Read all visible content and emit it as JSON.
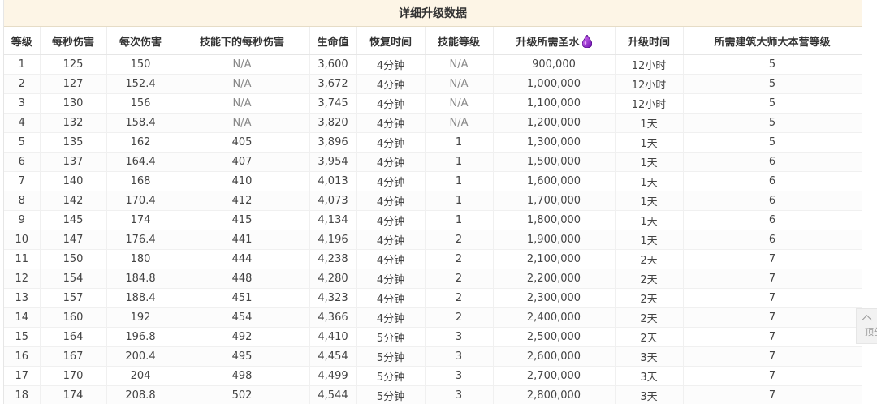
{
  "table": {
    "title": "详细升级数据",
    "headers": [
      "等级",
      "每秒伤害",
      "每次伤害",
      "技能下的每秒伤害",
      "生命值",
      "恢复时间",
      "技能等级",
      "升级所需圣水",
      "升级时间",
      "所需建筑大师大本营等级"
    ],
    "rows": [
      [
        "1",
        "125",
        "150",
        "N/A",
        "3,600",
        "4分钟",
        "N/A",
        "900,000",
        "12小时",
        "5"
      ],
      [
        "2",
        "127",
        "152.4",
        "N/A",
        "3,672",
        "4分钟",
        "N/A",
        "1,000,000",
        "12小时",
        "5"
      ],
      [
        "3",
        "130",
        "156",
        "N/A",
        "3,745",
        "4分钟",
        "N/A",
        "1,100,000",
        "12小时",
        "5"
      ],
      [
        "4",
        "132",
        "158.4",
        "N/A",
        "3,820",
        "4分钟",
        "N/A",
        "1,200,000",
        "1天",
        "5"
      ],
      [
        "5",
        "135",
        "162",
        "405",
        "3,896",
        "4分钟",
        "1",
        "1,300,000",
        "1天",
        "5"
      ],
      [
        "6",
        "137",
        "164.4",
        "407",
        "3,954",
        "4分钟",
        "1",
        "1,500,000",
        "1天",
        "6"
      ],
      [
        "7",
        "140",
        "168",
        "410",
        "4,013",
        "4分钟",
        "1",
        "1,600,000",
        "1天",
        "6"
      ],
      [
        "8",
        "142",
        "170.4",
        "412",
        "4,073",
        "4分钟",
        "1",
        "1,700,000",
        "1天",
        "6"
      ],
      [
        "9",
        "145",
        "174",
        "415",
        "4,134",
        "4分钟",
        "1",
        "1,800,000",
        "1天",
        "6"
      ],
      [
        "10",
        "147",
        "176.4",
        "441",
        "4,196",
        "4分钟",
        "2",
        "1,900,000",
        "1天",
        "6"
      ],
      [
        "11",
        "150",
        "180",
        "444",
        "4,238",
        "4分钟",
        "2",
        "2,100,000",
        "2天",
        "7"
      ],
      [
        "12",
        "154",
        "184.8",
        "448",
        "4,280",
        "4分钟",
        "2",
        "2,200,000",
        "2天",
        "7"
      ],
      [
        "13",
        "157",
        "188.4",
        "451",
        "4,323",
        "4分钟",
        "2",
        "2,300,000",
        "2天",
        "7"
      ],
      [
        "14",
        "160",
        "192",
        "454",
        "4,366",
        "4分钟",
        "2",
        "2,400,000",
        "2天",
        "7"
      ],
      [
        "15",
        "164",
        "196.8",
        "492",
        "4,410",
        "5分钟",
        "3",
        "2,500,000",
        "2天",
        "7"
      ],
      [
        "16",
        "167",
        "200.4",
        "495",
        "4,454",
        "5分钟",
        "3",
        "2,600,000",
        "3天",
        "7"
      ],
      [
        "17",
        "170",
        "204",
        "498",
        "4,499",
        "5分钟",
        "3",
        "2,700,000",
        "3天",
        "7"
      ],
      [
        "18",
        "174",
        "208.8",
        "502",
        "4,544",
        "5分钟",
        "3",
        "2,800,000",
        "3天",
        "7"
      ]
    ]
  },
  "elixir_icon": "elixir-drop-icon",
  "colors": {
    "title_bg": "#fdf5e6",
    "elixir": "#8a2be2"
  },
  "back_to_top": {
    "label": "顶部"
  }
}
